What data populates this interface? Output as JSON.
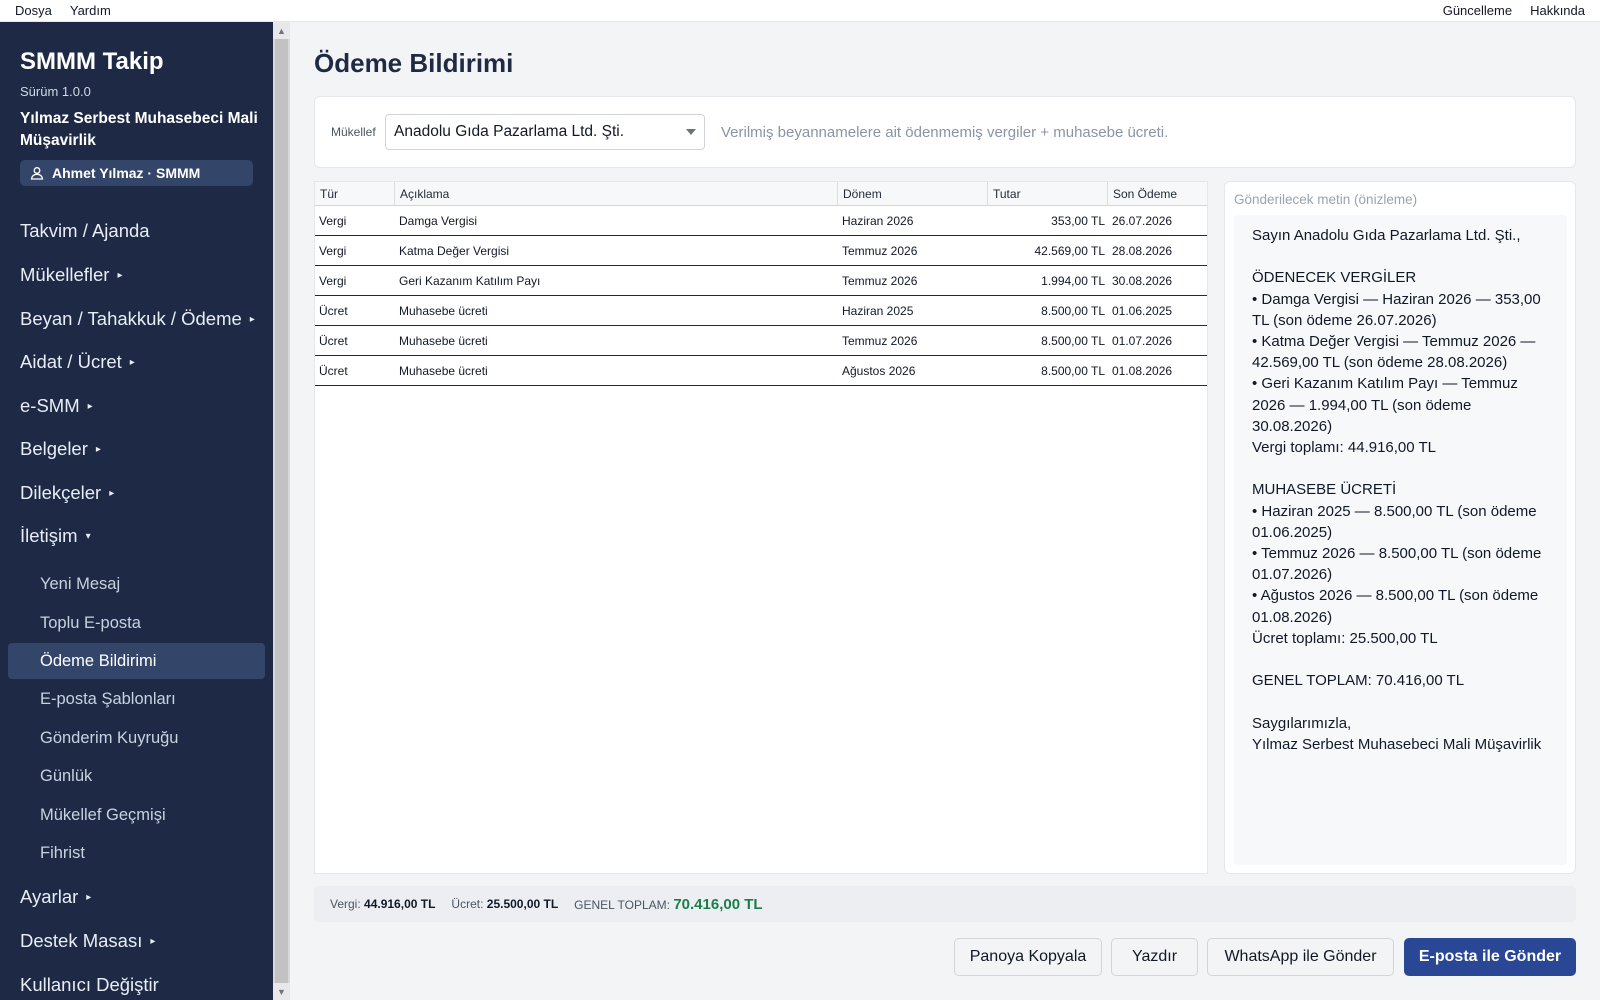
{
  "menubar": {
    "left": [
      "Dosya",
      "Yardım"
    ],
    "right": [
      "Güncelleme",
      "Hakkında"
    ]
  },
  "sidebar": {
    "app_title": "SMMM Takip",
    "version": "Sürüm 1.0.0",
    "company": "Yılmaz Serbest Muhasebeci Mali Müşavirlik",
    "user": "Ahmet Yılmaz · SMMM",
    "nav": [
      {
        "label": "Takvim / Ajanda",
        "arrow": ""
      },
      {
        "label": "Mükellefler",
        "arrow": "▸"
      },
      {
        "label": "Beyan / Tahakkuk / Ödeme",
        "arrow": "▸"
      },
      {
        "label": "Aidat / Ücret",
        "arrow": "▸"
      },
      {
        "label": "e-SMM",
        "arrow": "▸"
      },
      {
        "label": "Belgeler",
        "arrow": "▸"
      },
      {
        "label": "Dilekçeler",
        "arrow": "▸"
      },
      {
        "label": "İletişim",
        "arrow": "▾"
      },
      {
        "label": "Ayarlar",
        "arrow": "▸"
      },
      {
        "label": "Destek Masası",
        "arrow": "▸"
      },
      {
        "label": "Kullanıcı Değiştir",
        "arrow": ""
      }
    ],
    "sub": [
      "Yeni Mesaj",
      "Toplu E-posta",
      "Ödeme Bildirimi",
      "E-posta Şablonları",
      "Gönderim Kuyruğu",
      "Günlük",
      "Mükellef Geçmişi",
      "Fihrist"
    ]
  },
  "page": {
    "title": "Ödeme Bildirimi",
    "filter_label": "Mükellef",
    "selected_client": "Anadolu Gıda Pazarlama Ltd. Şti.",
    "hint": "Verilmiş beyannamelere ait ödenmemiş vergiler + muhasebe ücreti."
  },
  "table": {
    "headers": [
      "Tür",
      "Açıklama",
      "Dönem",
      "Tutar",
      "Son Ödeme"
    ],
    "rows": [
      [
        "Vergi",
        "Damga Vergisi",
        "Haziran 2026",
        "353,00 TL",
        "26.07.2026"
      ],
      [
        "Vergi",
        "Katma Değer Vergisi",
        "Temmuz 2026",
        "42.569,00 TL",
        "28.08.2026"
      ],
      [
        "Vergi",
        "Geri Kazanım Katılım Payı",
        "Temmuz 2026",
        "1.994,00 TL",
        "30.08.2026"
      ],
      [
        "Ücret",
        "Muhasebe ücreti",
        "Haziran 2025",
        "8.500,00 TL",
        "01.06.2025"
      ],
      [
        "Ücret",
        "Muhasebe ücreti",
        "Temmuz 2026",
        "8.500,00 TL",
        "01.07.2026"
      ],
      [
        "Ücret",
        "Muhasebe ücreti",
        "Ağustos 2026",
        "8.500,00 TL",
        "01.08.2026"
      ]
    ]
  },
  "preview": {
    "label": "Gönderilecek metin (önizleme)",
    "text": "Sayın Anadolu Gıda Pazarlama Ltd. Şti.,\n\nÖDENECEK VERGİLER\n• Damga Vergisi — Haziran 2026 — 353,00 TL (son ödeme 26.07.2026)\n• Katma Değer Vergisi — Temmuz 2026 — 42.569,00 TL (son ödeme 28.08.2026)\n• Geri Kazanım Katılım Payı — Temmuz 2026 — 1.994,00 TL (son ödeme 30.08.2026)\nVergi toplamı: 44.916,00 TL\n\nMUHASEBE ÜCRETİ\n• Haziran 2025 — 8.500,00 TL (son ödeme 01.06.2025)\n• Temmuz 2026 — 8.500,00 TL (son ödeme 01.07.2026)\n• Ağustos 2026 — 8.500,00 TL (son ödeme 01.08.2026)\nÜcret toplamı: 25.500,00 TL\n\nGENEL TOPLAM: 70.416,00 TL\n\nSaygılarımızla,\nYılmaz Serbest Muhasebeci Mali Müşavirlik"
  },
  "totals": {
    "tax_label": "Vergi:",
    "tax_value": "44.916,00 TL",
    "fee_label": "Ücret:",
    "fee_value": "25.500,00 TL",
    "grand_label": "GENEL TOPLAM:",
    "grand_value": "70.416,00 TL"
  },
  "buttons": {
    "copy": "Panoya Kopyala",
    "print": "Yazdır",
    "whatsapp": "WhatsApp ile Gönder",
    "email": "E-posta ile Gönder"
  },
  "colors": {
    "sidebar_bg": "#1e2a45",
    "accent": "#2a4796",
    "total_green": "#1a7f4b"
  },
  "icons": {
    "user": "user-icon",
    "dropdown": "chevron-down-icon"
  }
}
